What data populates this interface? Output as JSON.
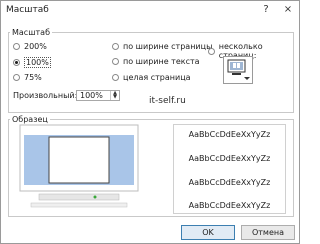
{
  "window": {
    "title": "Масштаб",
    "help_label": "?",
    "close_label": "×"
  },
  "zoom_group": {
    "label": "Масштаб",
    "options": [
      {
        "label": "200%",
        "selected": false
      },
      {
        "label": "100%",
        "selected": true
      },
      {
        "label": "75%",
        "selected": false
      },
      {
        "label": "по ширине страницы",
        "selected": false
      },
      {
        "label": "по ширине текста",
        "selected": false
      },
      {
        "label": "целая страница",
        "selected": false
      },
      {
        "label": "несколько страниц:",
        "selected": false
      }
    ],
    "custom_label": "Произвольный:",
    "custom_value": "100%",
    "pages_icon": "monitor-pages-icon"
  },
  "watermark": "it-self.ru",
  "preview_group": {
    "label": "Образец",
    "sample_lines": [
      "AaBbCcDdEeXxYyZz",
      "AaBbCcDdEeXxYyZz",
      "AaBbCcDdEeXxYyZz",
      "AaBbCcDdEeXxYyZz"
    ]
  },
  "buttons": {
    "ok": "OK",
    "cancel": "Отмена"
  }
}
